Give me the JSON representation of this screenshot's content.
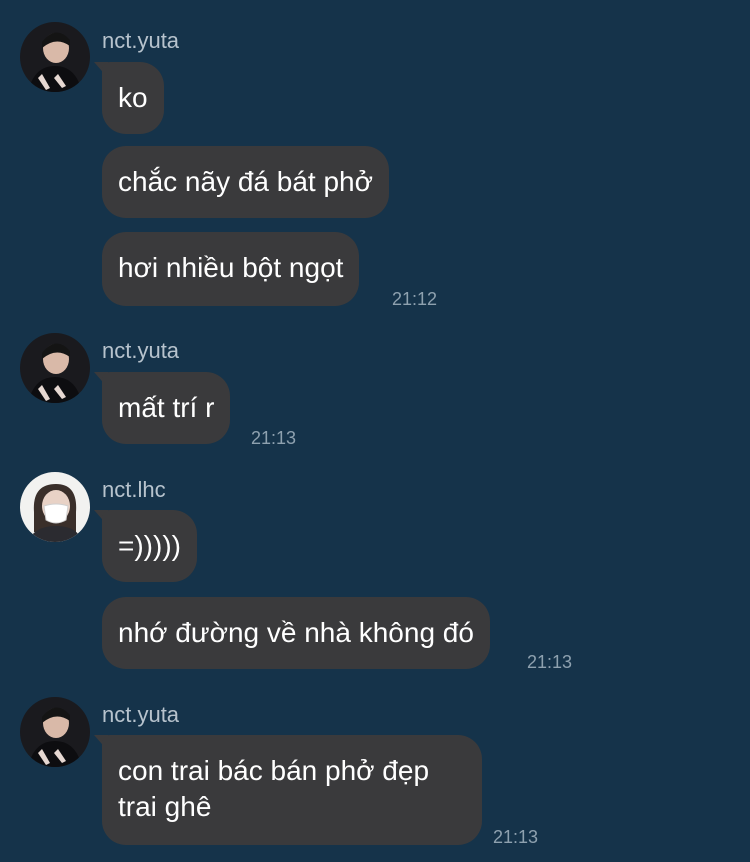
{
  "colors": {
    "background": "#15334a",
    "bubble": "#3a3a3c",
    "bubble_text": "#ffffff",
    "sender_text": "#b7c3cd",
    "timestamp": "#8ea1af"
  },
  "groups": [
    {
      "sender": "nct.yuta",
      "avatar_icon": "profile-photo-dark-suit",
      "messages": [
        "ko",
        "chắc nãy đá bát phở",
        "hơi nhiều bột ngọt"
      ],
      "time": "21:12"
    },
    {
      "sender": "nct.yuta",
      "avatar_icon": "profile-photo-dark-suit",
      "messages": [
        "mất trí r"
      ],
      "time": "21:13"
    },
    {
      "sender": "nct.lhc",
      "avatar_icon": "profile-photo-masked",
      "messages": [
        "=)))))",
        "nhớ đường về nhà không đó"
      ],
      "time": "21:13"
    },
    {
      "sender": "nct.yuta",
      "avatar_icon": "profile-photo-dark-suit",
      "messages": [
        "con trai bác bán phở đẹp trai ghê"
      ],
      "time": "21:13"
    }
  ]
}
